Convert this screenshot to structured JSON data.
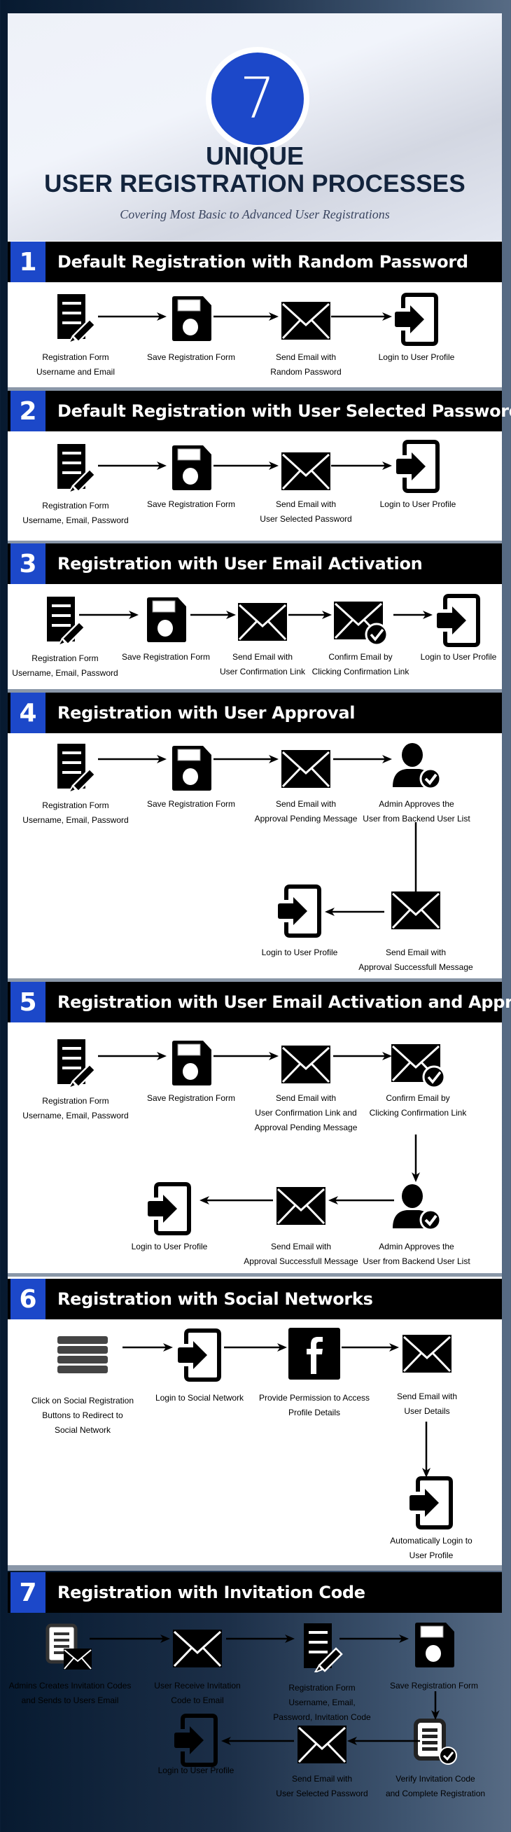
{
  "hero": {
    "badge_number": "7",
    "title_line1": "UNIQUE",
    "title_line2": "USER REGISTRATION PROCESSES",
    "subtitle": "Covering Most Basic to Advanced User Registrations"
  },
  "colors": {
    "accent_blue": "#1c48c9",
    "header_black": "#000000",
    "title_navy": "#13243d"
  },
  "sections": [
    {
      "number": "1",
      "title": "Default Registration with Random Password",
      "steps": [
        {
          "icon": "form-pencil-icon",
          "lines": [
            "Registration Form",
            "Username and Email"
          ]
        },
        {
          "icon": "save-floppy-icon",
          "lines": [
            "Save Registration Form"
          ]
        },
        {
          "icon": "envelope-icon",
          "lines": [
            "Send Email with",
            "Random Password"
          ]
        },
        {
          "icon": "login-icon",
          "lines": [
            "Login to User Profile"
          ]
        }
      ]
    },
    {
      "number": "2",
      "title": "Default Registration with User Selected Password",
      "steps": [
        {
          "icon": "form-pencil-icon",
          "lines": [
            "Registration Form",
            "Username, Email, Password"
          ]
        },
        {
          "icon": "save-floppy-icon",
          "lines": [
            "Save Registration Form"
          ]
        },
        {
          "icon": "envelope-icon",
          "lines": [
            "Send Email with",
            "User Selected Password"
          ]
        },
        {
          "icon": "login-icon",
          "lines": [
            "Login to User Profile"
          ]
        }
      ]
    },
    {
      "number": "3",
      "title": "Registration with User Email Activation",
      "steps": [
        {
          "icon": "form-pencil-icon",
          "lines": [
            "Registration Form",
            "Username, Email, Password"
          ]
        },
        {
          "icon": "save-floppy-icon",
          "lines": [
            "Save Registration Form"
          ]
        },
        {
          "icon": "envelope-icon",
          "lines": [
            "Send Email with",
            "User Confirmation Link"
          ]
        },
        {
          "icon": "envelope-check-icon",
          "lines": [
            "Confirm Email by",
            "Clicking Confirmation Link"
          ]
        },
        {
          "icon": "login-icon",
          "lines": [
            "Login to User Profile"
          ]
        }
      ]
    },
    {
      "number": "4",
      "title": "Registration with User Approval",
      "steps": [
        {
          "icon": "form-pencil-icon",
          "lines": [
            "Registration Form",
            "Username, Email, Password"
          ]
        },
        {
          "icon": "save-floppy-icon",
          "lines": [
            "Save Registration Form"
          ]
        },
        {
          "icon": "envelope-icon",
          "lines": [
            "Send Email with",
            "Approval Pending Message"
          ]
        },
        {
          "icon": "user-check-icon",
          "lines": [
            "Admin Approves the",
            "User from Backend User List"
          ]
        },
        {
          "icon": "envelope-icon",
          "lines": [
            "Send Email with",
            "Approval Successfull Message"
          ]
        },
        {
          "icon": "login-icon",
          "lines": [
            "Login to User Profile"
          ]
        }
      ]
    },
    {
      "number": "5",
      "title": "Registration with User Email Activation and Approval",
      "steps": [
        {
          "icon": "form-pencil-icon",
          "lines": [
            "Registration Form",
            "Username, Email, Password"
          ]
        },
        {
          "icon": "save-floppy-icon",
          "lines": [
            "Save Registration Form"
          ]
        },
        {
          "icon": "envelope-icon",
          "lines": [
            "Send Email with",
            "User Confirmation Link and",
            "Approval Pending Message"
          ]
        },
        {
          "icon": "envelope-check-icon",
          "lines": [
            "Confirm Email by",
            "Clicking Confirmation Link"
          ]
        },
        {
          "icon": "user-check-icon",
          "lines": [
            "Admin Approves the",
            "User from Backend User List"
          ]
        },
        {
          "icon": "envelope-icon",
          "lines": [
            "Send Email with",
            "Approval Successfull Message"
          ]
        },
        {
          "icon": "login-icon",
          "lines": [
            "Login to User Profile"
          ]
        }
      ]
    },
    {
      "number": "6",
      "title": "Registration with Social Networks",
      "steps": [
        {
          "icon": "hamburger-buttons-icon",
          "lines": [
            "Click on Social Registration",
            "Buttons to Redirect to",
            "Social Network"
          ]
        },
        {
          "icon": "login-icon",
          "lines": [
            "Login to Social Network"
          ]
        },
        {
          "icon": "facebook-icon",
          "lines": [
            "Provide Permission to Access",
            "Profile Details"
          ]
        },
        {
          "icon": "envelope-icon",
          "lines": [
            "Send Email with",
            "User Details"
          ]
        },
        {
          "icon": "login-icon",
          "lines": [
            "Automatically Login to",
            "User Profile"
          ]
        }
      ]
    },
    {
      "number": "7",
      "title": "Registration with Invitation Code",
      "steps": [
        {
          "icon": "document-envelope-icon",
          "lines": [
            "Admins Creates Invitation Codes",
            "and Sends to Users Email"
          ]
        },
        {
          "icon": "envelope-icon",
          "lines": [
            "User Receive Invitation",
            "Code to Email"
          ]
        },
        {
          "icon": "form-pencil-icon",
          "lines": [
            "Registration Form",
            "Username, Email,",
            "Password, Invitation Code"
          ]
        },
        {
          "icon": "save-floppy-icon",
          "lines": [
            "Save Registration Form"
          ]
        },
        {
          "icon": "document-check-icon",
          "lines": [
            "Verify Invitation Code",
            "and Complete Registration"
          ]
        },
        {
          "icon": "envelope-icon",
          "lines": [
            "Send Email with",
            "User Selected Password"
          ]
        },
        {
          "icon": "login-icon",
          "lines": [
            "Login to User Profile"
          ]
        }
      ]
    }
  ]
}
